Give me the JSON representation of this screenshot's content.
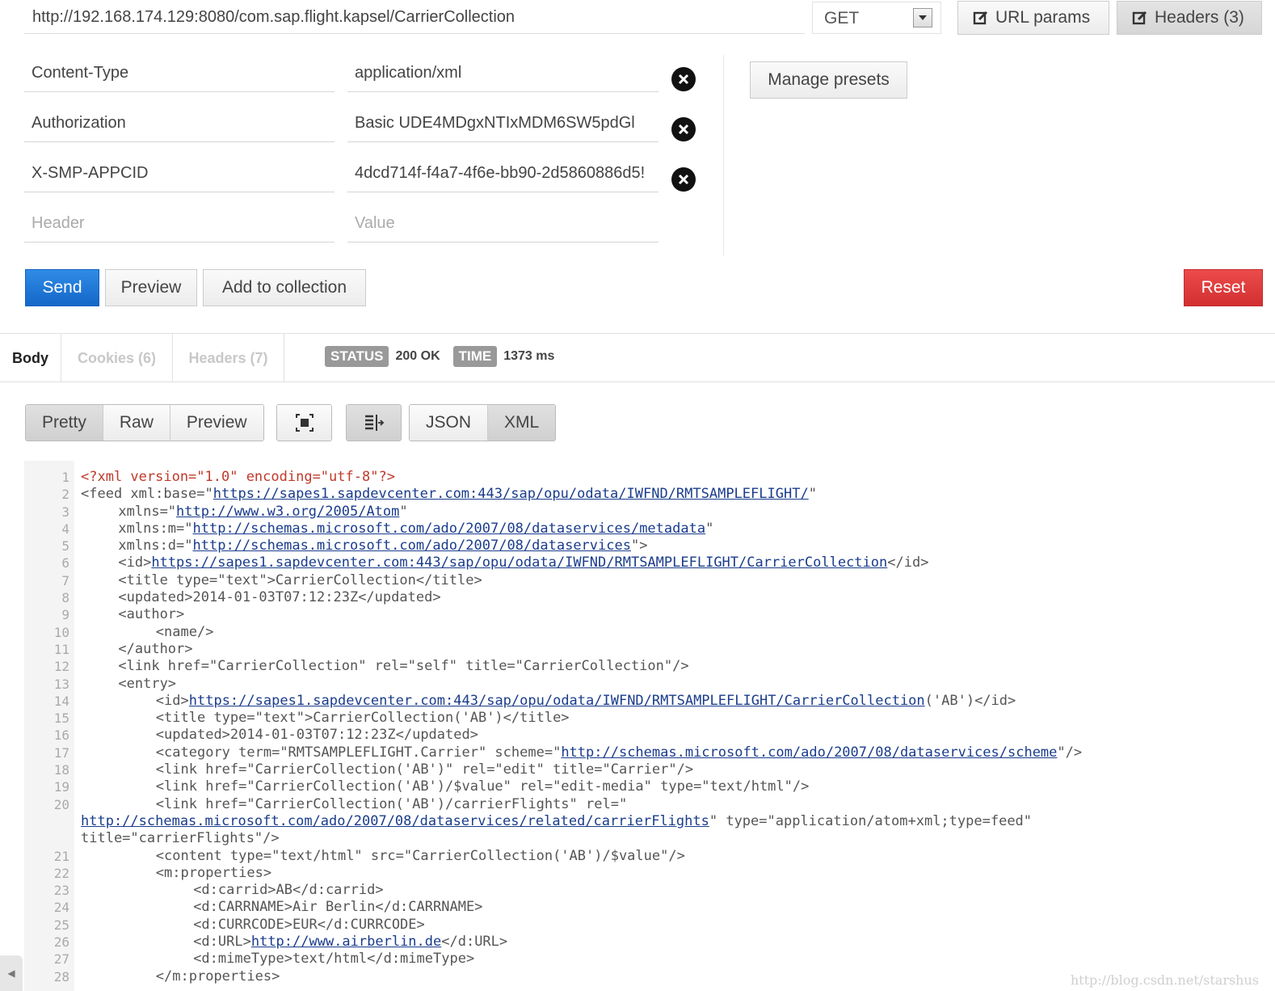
{
  "request": {
    "url": "http://192.168.174.129:8080/com.sap.flight.kapsel/CarrierCollection",
    "method": "GET",
    "url_params_label": "URL params",
    "headers_label": "Headers (3)"
  },
  "headers": [
    {
      "key": "Content-Type",
      "value": "application/xml"
    },
    {
      "key": "Authorization",
      "value": "Basic UDE4MDgxNTIxMDM6SW5pdGl"
    },
    {
      "key": "X-SMP-APPCID",
      "value": "4dcd714f-f4a7-4f6e-bb90-2d5860886d5!"
    }
  ],
  "header_placeholder": {
    "key": "Header",
    "value": "Value"
  },
  "manage_presets_label": "Manage presets",
  "actions": {
    "send": "Send",
    "preview": "Preview",
    "add_to_collection": "Add to collection",
    "reset": "Reset"
  },
  "response": {
    "tabs": [
      "Body",
      "Cookies (6)",
      "Headers (7)"
    ],
    "status_label": "STATUS",
    "status_value": "200 OK",
    "time_label": "TIME",
    "time_value": "1373 ms"
  },
  "view": {
    "modes": [
      "Pretty",
      "Raw",
      "Preview"
    ],
    "formats": [
      "JSON",
      "XML"
    ]
  },
  "code_lines": [
    {
      "n": "1",
      "indent": 0,
      "parts": [
        [
          "pi",
          "<?xml version=\"1.0\" encoding=\"utf-8\"?>"
        ]
      ]
    },
    {
      "n": "2",
      "indent": 0,
      "parts": [
        [
          "t",
          "<feed xml:base=\""
        ],
        [
          "l",
          "https://sapes1.sapdevcenter.com:443/sap/opu/odata/IWFND/RMTSAMPLEFLIGHT/"
        ],
        [
          "t",
          "\""
        ]
      ]
    },
    {
      "n": "3",
      "indent": 4,
      "parts": [
        [
          "t",
          "xmlns=\""
        ],
        [
          "l",
          "http://www.w3.org/2005/Atom"
        ],
        [
          "t",
          "\""
        ]
      ]
    },
    {
      "n": "4",
      "indent": 4,
      "parts": [
        [
          "t",
          "xmlns:m=\""
        ],
        [
          "l",
          "http://schemas.microsoft.com/ado/2007/08/dataservices/metadata"
        ],
        [
          "t",
          "\""
        ]
      ]
    },
    {
      "n": "5",
      "indent": 4,
      "parts": [
        [
          "t",
          "xmlns:d=\""
        ],
        [
          "l",
          "http://schemas.microsoft.com/ado/2007/08/dataservices"
        ],
        [
          "t",
          "\">"
        ]
      ]
    },
    {
      "n": "6",
      "indent": 4,
      "parts": [
        [
          "t",
          "<id>"
        ],
        [
          "l",
          "https://sapes1.sapdevcenter.com:443/sap/opu/odata/IWFND/RMTSAMPLEFLIGHT/CarrierCollection"
        ],
        [
          "t",
          "</id>"
        ]
      ]
    },
    {
      "n": "7",
      "indent": 4,
      "parts": [
        [
          "t",
          "<title type=\"text\">CarrierCollection</title>"
        ]
      ]
    },
    {
      "n": "8",
      "indent": 4,
      "parts": [
        [
          "t",
          "<updated>2014-01-03T07:12:23Z</updated>"
        ]
      ]
    },
    {
      "n": "9",
      "indent": 4,
      "parts": [
        [
          "t",
          "<author>"
        ]
      ]
    },
    {
      "n": "10",
      "indent": 8,
      "parts": [
        [
          "t",
          "<name/>"
        ]
      ]
    },
    {
      "n": "11",
      "indent": 4,
      "parts": [
        [
          "t",
          "</author>"
        ]
      ]
    },
    {
      "n": "12",
      "indent": 4,
      "parts": [
        [
          "t",
          "<link href=\"CarrierCollection\" rel=\"self\" title=\"CarrierCollection\"/>"
        ]
      ]
    },
    {
      "n": "13",
      "indent": 4,
      "parts": [
        [
          "t",
          "<entry>"
        ]
      ]
    },
    {
      "n": "14",
      "indent": 8,
      "parts": [
        [
          "t",
          "<id>"
        ],
        [
          "l",
          "https://sapes1.sapdevcenter.com:443/sap/opu/odata/IWFND/RMTSAMPLEFLIGHT/CarrierCollection"
        ],
        [
          "t",
          "('AB')</id>"
        ]
      ]
    },
    {
      "n": "15",
      "indent": 8,
      "parts": [
        [
          "t",
          "<title type=\"text\">CarrierCollection('AB')</title>"
        ]
      ]
    },
    {
      "n": "16",
      "indent": 8,
      "parts": [
        [
          "t",
          "<updated>2014-01-03T07:12:23Z</updated>"
        ]
      ]
    },
    {
      "n": "17",
      "indent": 8,
      "parts": [
        [
          "t",
          "<category term=\"RMTSAMPLEFLIGHT.Carrier\" scheme=\""
        ],
        [
          "l",
          "http://schemas.microsoft.com/ado/2007/08/dataservices/scheme"
        ],
        [
          "t",
          "\"/>"
        ]
      ]
    },
    {
      "n": "18",
      "indent": 8,
      "parts": [
        [
          "t",
          "<link href=\"CarrierCollection('AB')\" rel=\"edit\" title=\"Carrier\"/>"
        ]
      ]
    },
    {
      "n": "19",
      "indent": 8,
      "parts": [
        [
          "t",
          "<link href=\"CarrierCollection('AB')/$value\" rel=\"edit-media\" type=\"text/html\"/>"
        ]
      ]
    },
    {
      "n": "20",
      "indent": 8,
      "parts": [
        [
          "t",
          "<link href=\"CarrierCollection('AB')/carrierFlights\" rel=\""
        ]
      ]
    },
    {
      "n": "",
      "indent": 0,
      "parts": [
        [
          "l",
          "http://schemas.microsoft.com/ado/2007/08/dataservices/related/carrierFlights"
        ],
        [
          "t",
          "\" type=\"application/atom+xml;type=feed\""
        ]
      ]
    },
    {
      "n": "",
      "indent": 0,
      "parts": [
        [
          "t",
          "title=\"carrierFlights\"/>"
        ]
      ]
    },
    {
      "n": "21",
      "indent": 8,
      "parts": [
        [
          "t",
          "<content type=\"text/html\" src=\"CarrierCollection('AB')/$value\"/>"
        ]
      ]
    },
    {
      "n": "22",
      "indent": 8,
      "parts": [
        [
          "t",
          "<m:properties>"
        ]
      ]
    },
    {
      "n": "23",
      "indent": 12,
      "parts": [
        [
          "t",
          "<d:carrid>AB</d:carrid>"
        ]
      ]
    },
    {
      "n": "24",
      "indent": 12,
      "parts": [
        [
          "t",
          "<d:CARRNAME>Air Berlin</d:CARRNAME>"
        ]
      ]
    },
    {
      "n": "25",
      "indent": 12,
      "parts": [
        [
          "t",
          "<d:CURRCODE>EUR</d:CURRCODE>"
        ]
      ]
    },
    {
      "n": "26",
      "indent": 12,
      "parts": [
        [
          "t",
          "<d:URL>"
        ],
        [
          "l",
          "http://www.airberlin.de"
        ],
        [
          "t",
          "</d:URL>"
        ]
      ]
    },
    {
      "n": "27",
      "indent": 12,
      "parts": [
        [
          "t",
          "<d:mimeType>text/html</d:mimeType>"
        ]
      ]
    },
    {
      "n": "28",
      "indent": 8,
      "parts": [
        [
          "t",
          "</m:properties>"
        ]
      ]
    }
  ],
  "watermark": "http://blog.csdn.net/starshus",
  "colors": {
    "send": "#1a6fd6",
    "reset": "#e03c3c",
    "link": "#1a3c8c",
    "pi": "#c0392b"
  }
}
